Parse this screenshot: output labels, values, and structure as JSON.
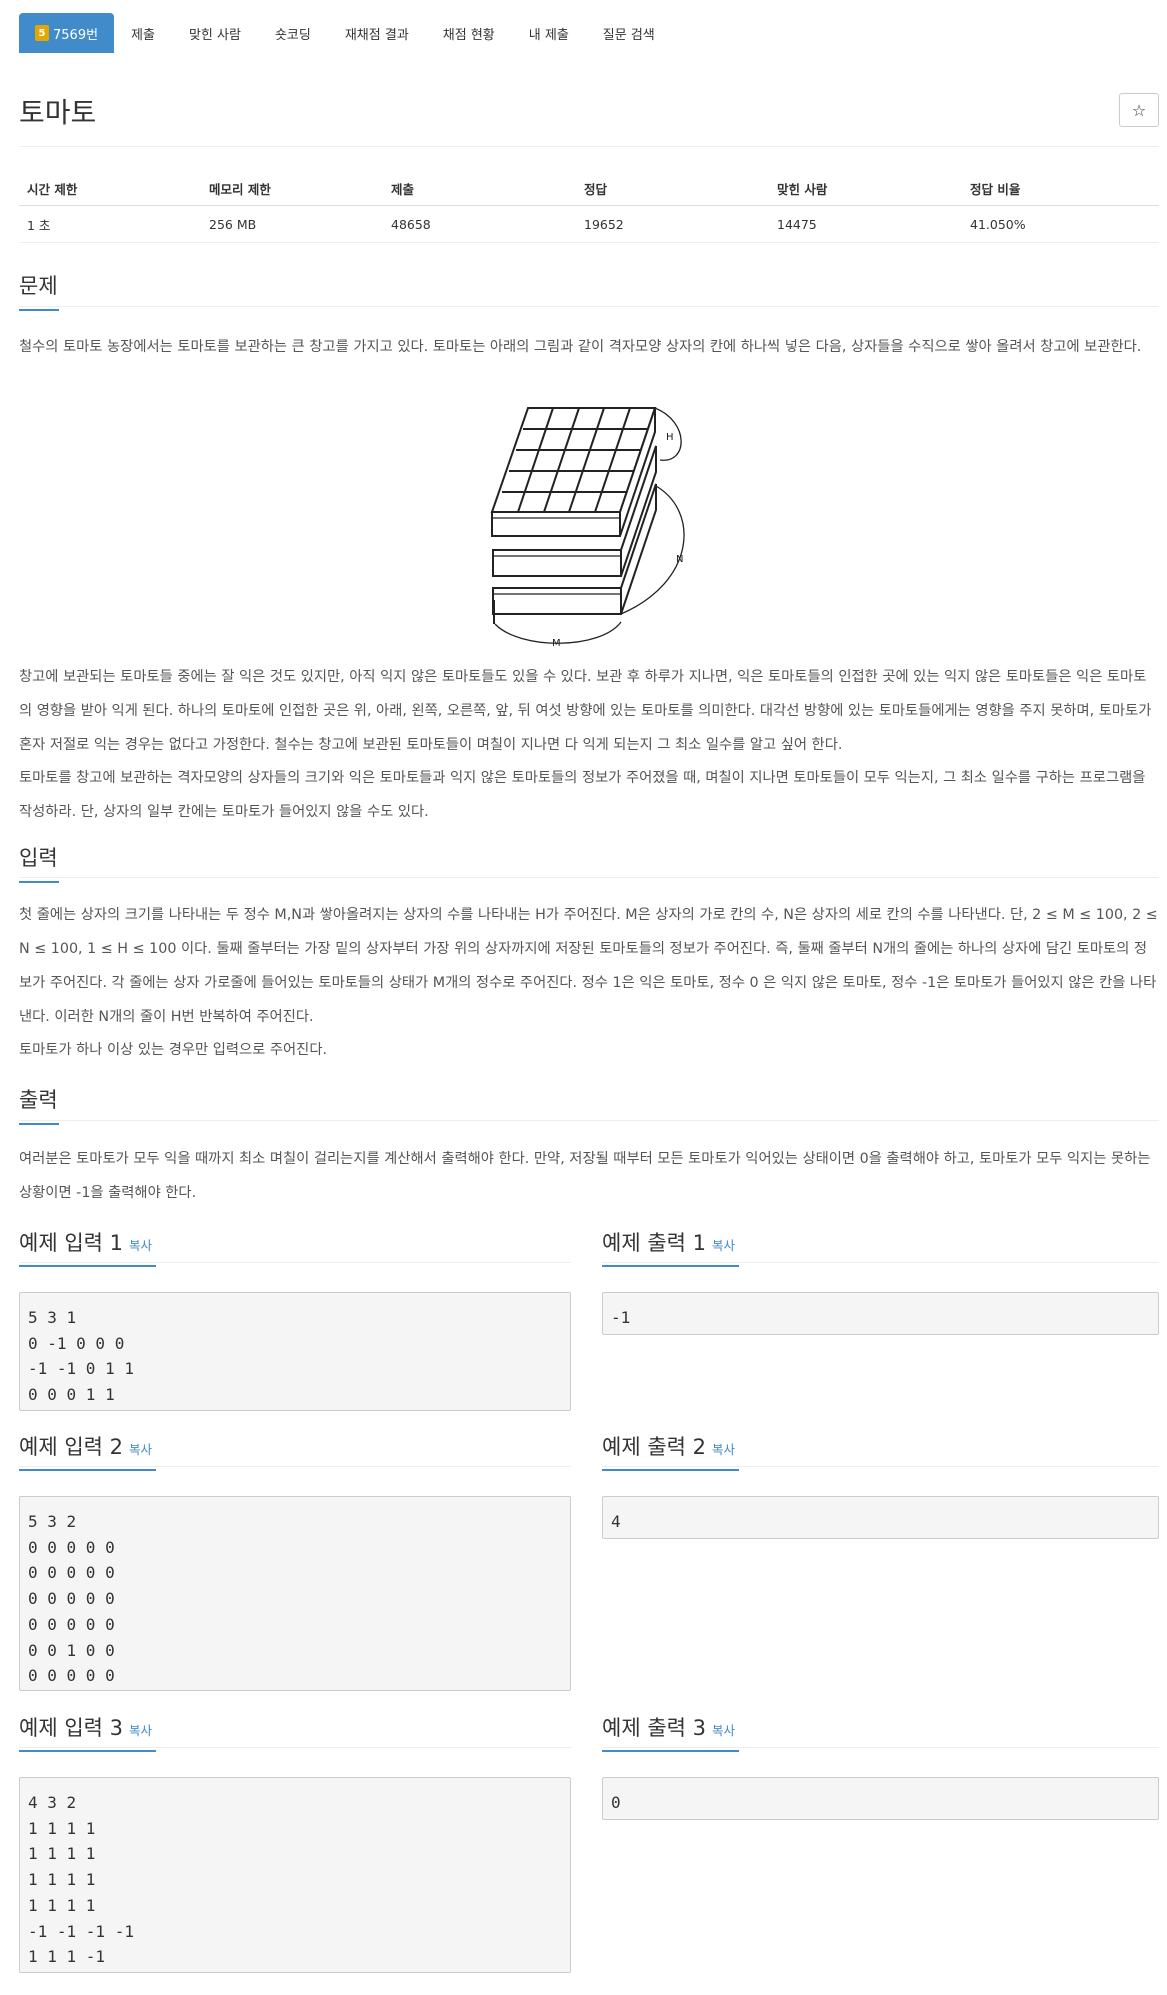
{
  "nav": {
    "problem_badge": "5",
    "problem_tab": "7569번",
    "tabs": [
      "제출",
      "맞힌 사람",
      "숏코딩",
      "재채점 결과",
      "채점 현황",
      "내 제출",
      "질문 검색"
    ]
  },
  "problem": {
    "title": "토마토",
    "star": "☆"
  },
  "info_table": {
    "headers": [
      "시간 제한",
      "메모리 제한",
      "제출",
      "정답",
      "맞힌 사람",
      "정답 비율"
    ],
    "values": [
      "1 초",
      "256 MB",
      "48658",
      "19652",
      "14475",
      "41.050%"
    ]
  },
  "sections": {
    "problem_heading": "문제",
    "problem_p1": "철수의 토마토 농장에서는 토마토를 보관하는 큰 창고를 가지고 있다. 토마토는 아래의 그림과 같이 격자모양 상자의 칸에 하나씩 넣은 다음, 상자들을 수직으로 쌓아 올려서 창고에 보관한다.",
    "problem_p2": "창고에 보관되는 토마토들 중에는 잘 익은 것도 있지만, 아직 익지 않은 토마토들도 있을 수 있다. 보관 후 하루가 지나면, 익은 토마토들의 인접한 곳에 있는 익지 않은 토마토들은 익은 토마토의 영향을 받아 익게 된다. 하나의 토마토에 인접한 곳은 위, 아래, 왼쪽, 오른쪽, 앞, 뒤 여섯 방향에 있는 토마토를 의미한다. 대각선 방향에 있는 토마토들에게는 영향을 주지 못하며, 토마토가 혼자 저절로 익는 경우는 없다고 가정한다. 철수는 창고에 보관된 토마토들이 며칠이 지나면 다 익게 되는지 그 최소 일수를 알고 싶어 한다.",
    "problem_p3": "토마토를 창고에 보관하는 격자모양의 상자들의 크기와 익은 토마토들과 익지 않은 토마토들의 정보가 주어졌을 때, 며칠이 지나면 토마토들이 모두 익는지, 그 최소 일수를 구하는 프로그램을 작성하라. 단, 상자의 일부 칸에는 토마토가 들어있지 않을 수도 있다.",
    "input_heading": "입력",
    "input_p1": "첫 줄에는 상자의 크기를 나타내는 두 정수 M,N과 쌓아올려지는 상자의 수를 나타내는 H가 주어진다. M은 상자의 가로 칸의 수, N은 상자의 세로 칸의 수를 나타낸다. 단, 2 ≤ M ≤ 100, 2 ≤ N ≤ 100, 1 ≤ H ≤ 100 이다. 둘째 줄부터는 가장 밑의 상자부터 가장 위의 상자까지에 저장된 토마토들의 정보가 주어진다. 즉, 둘째 줄부터 N개의 줄에는 하나의 상자에 담긴 토마토의 정보가 주어진다. 각 줄에는 상자 가로줄에 들어있는 토마토들의 상태가 M개의 정수로 주어진다. 정수 1은 익은 토마토, 정수 0 은 익지 않은 토마토, 정수 -1은 토마토가 들어있지 않은 칸을 나타낸다. 이러한 N개의 줄이 H번 반복하여 주어진다.",
    "input_p2": "토마토가 하나 이상 있는 경우만 입력으로 주어진다.",
    "output_heading": "출력",
    "output_p1": "여러분은 토마토가 모두 익을 때까지 최소 며칠이 걸리는지를 계산해서 출력해야 한다. 만약, 저장될 때부터 모든 토마토가 익어있는 상태이면 0을 출력해야 하고, 토마토가 모두 익지는 못하는 상황이면 -1을 출력해야 한다."
  },
  "figure_labels": {
    "h": "H",
    "n": "N",
    "m": "M"
  },
  "samples": {
    "copy_label": "복사",
    "in1_title": "예제 입력 1",
    "out1_title": "예제 출력 1",
    "in2_title": "예제 입력 2",
    "out2_title": "예제 출력 2",
    "in3_title": "예제 입력 3",
    "out3_title": "예제 출력 3",
    "in1": "5 3 1\n0 -1 0 0 0\n-1 -1 0 1 1\n0 0 0 1 1",
    "out1": "-1",
    "in2": "5 3 2\n0 0 0 0 0\n0 0 0 0 0\n0 0 0 0 0\n0 0 0 0 0\n0 0 1 0 0\n0 0 0 0 0",
    "out2": "4",
    "in3": "4 3 2\n1 1 1 1\n1 1 1 1\n1 1 1 1\n1 1 1 1\n-1 -1 -1 -1\n1 1 1 -1",
    "out3": "0"
  }
}
